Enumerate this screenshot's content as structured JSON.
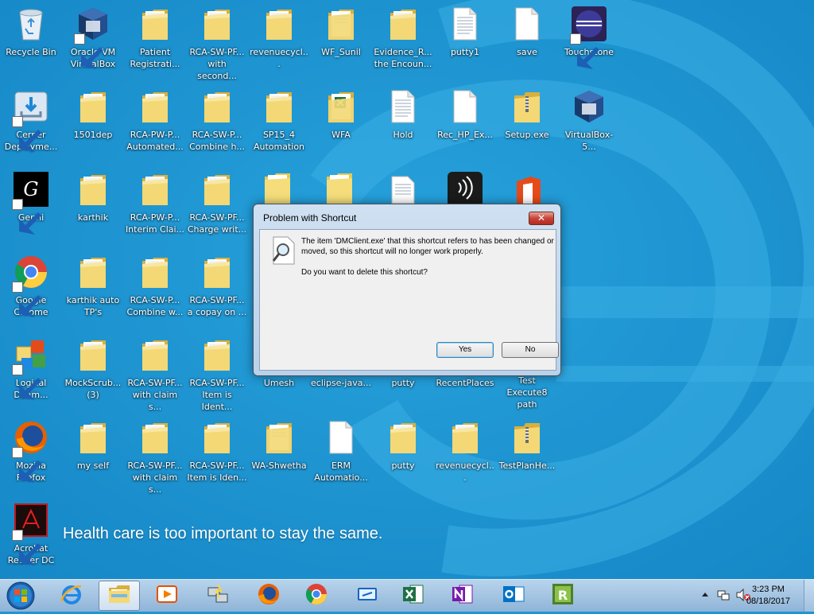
{
  "desktop": {
    "tagline": "Health care is too important to stay the same.",
    "icons": [
      {
        "label": "Recycle Bin",
        "type": "recycle",
        "shortcut": false
      },
      {
        "label": "Oracle VM\nVirtualBox",
        "type": "vbox",
        "shortcut": true
      },
      {
        "label": "Patient\nRegistrati...",
        "type": "folder",
        "shortcut": false
      },
      {
        "label": "RCA-SW-PF...\nwith second...",
        "type": "folder",
        "shortcut": false
      },
      {
        "label": "revenuecycl...",
        "type": "folder",
        "shortcut": false
      },
      {
        "label": "WF_Sunil",
        "type": "folder-doc",
        "shortcut": false
      },
      {
        "label": "Evidence_R...\nthe Encoun...",
        "type": "folder",
        "shortcut": false
      },
      {
        "label": "putty1",
        "type": "textfile",
        "shortcut": false
      },
      {
        "label": "save",
        "type": "file",
        "shortcut": false
      },
      {
        "label": "Touchstone",
        "type": "eclipse",
        "shortcut": true
      },
      {
        "label": "Cerner\nDeployme...",
        "type": "cerner",
        "shortcut": true
      },
      {
        "label": "1501dep",
        "type": "folder",
        "shortcut": false
      },
      {
        "label": "RCA-PW-P...\nAutomated...",
        "type": "folder",
        "shortcut": false
      },
      {
        "label": "RCA-SW-P...\nCombine h...",
        "type": "folder",
        "shortcut": false
      },
      {
        "label": "SP15_4\nAutomation",
        "type": "folder",
        "shortcut": false
      },
      {
        "label": "WFA",
        "type": "folder-xls",
        "shortcut": false
      },
      {
        "label": "Hold",
        "type": "textfile",
        "shortcut": false
      },
      {
        "label": "Rec_HP_Ex...",
        "type": "file",
        "shortcut": false
      },
      {
        "label": "Setup.exe",
        "type": "zipfolder",
        "shortcut": false
      },
      {
        "label": "VirtualBox-5...",
        "type": "vbox",
        "shortcut": false
      },
      {
        "label": "Gephi",
        "type": "gephi",
        "shortcut": true
      },
      {
        "label": "karthik",
        "type": "folder",
        "shortcut": false
      },
      {
        "label": "RCA-PW-P...\nInterim Clai...",
        "type": "folder",
        "shortcut": false
      },
      {
        "label": "RCA-SW-PF...\nCharge writ...",
        "type": "folder",
        "shortcut": false
      },
      {
        "label": "Google\nChrome",
        "type": "chrome",
        "shortcut": true
      },
      {
        "label": "karthik auto\nTP's",
        "type": "folder",
        "shortcut": false
      },
      {
        "label": "RCA-SW-P...\nCombine w...",
        "type": "folder",
        "shortcut": false
      },
      {
        "label": "RCA-SW-PF...\na copay on ...",
        "type": "folder",
        "shortcut": false
      },
      {
        "label": "Logical\nDoam...",
        "type": "logical",
        "shortcut": true
      },
      {
        "label": "MockScrub...\n(3)",
        "type": "folder",
        "shortcut": false
      },
      {
        "label": "RCA-SW-PF...\nwith claim s...",
        "type": "folder",
        "shortcut": false
      },
      {
        "label": "RCA-SW-PF...\nItem is Ident...",
        "type": "folder",
        "shortcut": false
      },
      {
        "label": "Umesh",
        "type": "none",
        "shortcut": false
      },
      {
        "label": "eclipse-java...",
        "type": "none",
        "shortcut": false
      },
      {
        "label": "putty",
        "type": "none",
        "shortcut": false
      },
      {
        "label": "RecentPlaces",
        "type": "none",
        "shortcut": false
      },
      {
        "label": "Test Execute8\npath",
        "type": "none",
        "shortcut": false
      },
      {
        "label": "Mozilla\nFirefox",
        "type": "firefox",
        "shortcut": true
      },
      {
        "label": "my self",
        "type": "folder",
        "shortcut": false
      },
      {
        "label": "RCA-SW-PF...\nwith claim s...",
        "type": "folder",
        "shortcut": false
      },
      {
        "label": "RCA-SW-PF...\nItem is Iden...",
        "type": "folder",
        "shortcut": false
      },
      {
        "label": "WA-Shwetha",
        "type": "folder-doc",
        "shortcut": false
      },
      {
        "label": "ERM\nAutomatio...",
        "type": "file",
        "shortcut": false
      },
      {
        "label": "putty",
        "type": "folder",
        "shortcut": false
      },
      {
        "label": "revenuecycl...",
        "type": "folder",
        "shortcut": false
      },
      {
        "label": "TestPlanHe...",
        "type": "zipfolder",
        "shortcut": false
      },
      {
        "label": "Acrobat\nReader DC",
        "type": "acrobat",
        "shortcut": true
      }
    ],
    "partial_icons": [
      "folder",
      "folder-shortcut",
      "textfile",
      "nfc",
      "office"
    ]
  },
  "dialog": {
    "title": "Problem with Shortcut",
    "close_label": "✕",
    "message": "The item 'DMClient.exe' that this shortcut refers to has been changed or moved, so this shortcut will no longer work properly.",
    "question": "Do you want to delete this shortcut?",
    "yes_label": "Yes",
    "no_label": "No"
  },
  "taskbar": {
    "apps": [
      "internet-explorer",
      "file-explorer",
      "media-player",
      "network-tool",
      "firefox",
      "chrome",
      "remote-desktop",
      "excel",
      "onenote",
      "outlook",
      "rational"
    ],
    "time": "3:23 PM",
    "date": "08/18/2017"
  },
  "colors": {
    "desktop_bg": "#1f95d2",
    "dialog_close": "#c7443a"
  }
}
